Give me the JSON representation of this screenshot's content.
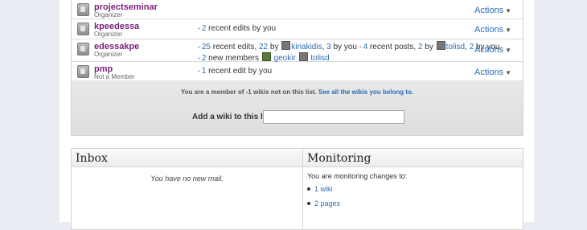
{
  "wikis": [
    {
      "name": "projectseminar",
      "role": "Organizer",
      "activity": [],
      "actions_label": "Actions"
    },
    {
      "name": "kpeedessa",
      "role": "Organizer",
      "actions_label": "Actions"
    },
    {
      "name": "edessakpe",
      "role": "Organizer",
      "actions_label": "Actions"
    },
    {
      "name": "pmp",
      "role": "Not a Member",
      "actions_label": "Actions"
    }
  ],
  "activity": {
    "kpeedessa": {
      "count": "2",
      "text": " recent edits by you"
    },
    "edessakpe": {
      "count": "25",
      "t1": " recent edits, ",
      "c2": "22",
      "t2": " by ",
      "u1": "kiriakidis",
      "t3": ", ",
      "c3": "3",
      "t4": " by you ",
      "c4": "4",
      "t5": " recent posts, ",
      "c5": "2",
      "t6": " by ",
      "u2": "tolisd",
      "t7": ", ",
      "c6": "2",
      "t8": " by you",
      "c7": "2",
      "t9": " new members ",
      "u3": "geokir",
      "u4": "tolisd"
    },
    "pmp": {
      "count": "1",
      "text": " recent edit by you"
    }
  },
  "member_note": {
    "text": "You are a member of -1 wikis not on this list. ",
    "link": "See all the wikis you belong to."
  },
  "add_wiki": {
    "label": "Add a wiki to this list:",
    "value": ""
  },
  "inbox": {
    "title": "Inbox",
    "empty": "You have no new mail."
  },
  "monitoring": {
    "title": "Monitoring",
    "intro": "You are monitoring changes to:",
    "items": [
      "1 wiki",
      "2 pages"
    ]
  },
  "colors": {
    "link": "#2a6db5",
    "wiki_name": "#7b1f7b",
    "background": "#e9edf3"
  }
}
